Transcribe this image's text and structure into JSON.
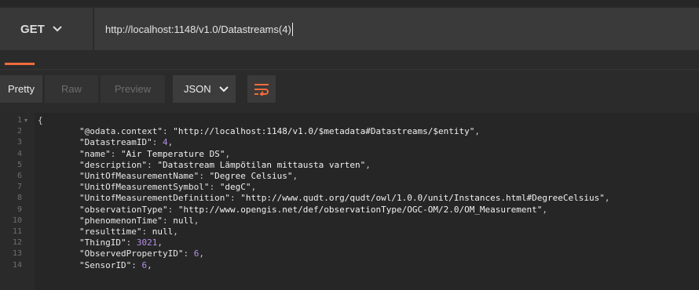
{
  "request": {
    "method": "GET",
    "url": "http://localhost:1148/v1.0/Datastreams(4)"
  },
  "response_toolbar": {
    "modes": [
      "Pretty",
      "Raw",
      "Preview"
    ],
    "active_mode": "Pretty",
    "format": "JSON"
  },
  "colors": {
    "accent": "#f26b3a",
    "number": "#b48ee8"
  },
  "icons": {
    "method_dropdown": "chevron-down-icon",
    "format_dropdown": "chevron-down-icon",
    "wrap": "wrap-lines-icon",
    "fold": "fold-toggle-icon"
  },
  "code": {
    "lines": [
      {
        "n": "1",
        "open": "{"
      },
      {
        "n": "2",
        "key": "\"@odata.context\"",
        "val": "\"http://localhost:1148/v1.0/$metadata#Datastreams/$entity\"",
        "type": "str"
      },
      {
        "n": "3",
        "key": "\"DatastreamID\"",
        "val": "4",
        "type": "num"
      },
      {
        "n": "4",
        "key": "\"name\"",
        "val": "\"Air Temperature DS\"",
        "type": "str"
      },
      {
        "n": "5",
        "key": "\"description\"",
        "val": "\"Datastream Lämpötilan mittausta varten\"",
        "type": "str"
      },
      {
        "n": "6",
        "key": "\"UnitOfMeasurementName\"",
        "val": "\"Degree Celsius\"",
        "type": "str"
      },
      {
        "n": "7",
        "key": "\"UnitOfMeasurementSymbol\"",
        "val": "\"degC\"",
        "type": "str"
      },
      {
        "n": "8",
        "key": "\"UnitofMeasurementDefinition\"",
        "val": "\"http://www.qudt.org/qudt/owl/1.0.0/unit/Instances.html#DegreeCelsius\"",
        "type": "str"
      },
      {
        "n": "9",
        "key": "\"observationType\"",
        "val": "\"http://www.opengis.net/def/observationType/OGC-OM/2.0/OM_Measurement\"",
        "type": "str"
      },
      {
        "n": "10",
        "key": "\"phenomenonTime\"",
        "val": "null",
        "type": "kw"
      },
      {
        "n": "11",
        "key": "\"resulttime\"",
        "val": "null",
        "type": "kw"
      },
      {
        "n": "12",
        "key": "\"ThingID\"",
        "val": "3021",
        "type": "num"
      },
      {
        "n": "13",
        "key": "\"ObservedPropertyID\"",
        "val": "6",
        "type": "num"
      },
      {
        "n": "14",
        "key": "\"SensorID\"",
        "val": "6",
        "type": "num"
      }
    ]
  }
}
